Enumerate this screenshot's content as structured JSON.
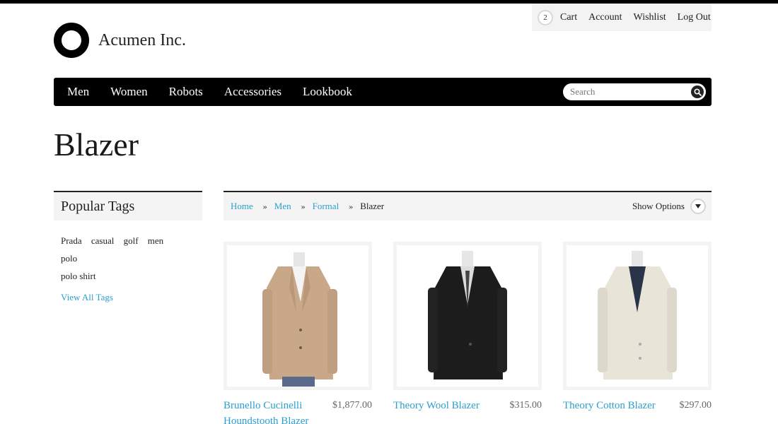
{
  "header": {
    "cart_count": "2",
    "links": [
      "Cart",
      "Account",
      "Wishlist",
      "Log Out"
    ],
    "brand": "Acumen Inc."
  },
  "nav": {
    "items": [
      "Men",
      "Women",
      "Robots",
      "Accessories",
      "Lookbook"
    ],
    "search_placeholder": "Search"
  },
  "page": {
    "title": "Blazer"
  },
  "sidebar": {
    "heading": "Popular Tags",
    "tags": [
      "Prada",
      "casual",
      "golf",
      "men",
      "polo",
      "polo shirt"
    ],
    "view_all": "View All Tags"
  },
  "breadcrumb": {
    "items": [
      "Home",
      "Men",
      "Formal"
    ],
    "separator": "»",
    "current": "Blazer",
    "show_options": "Show Options"
  },
  "products": [
    {
      "name": "Brunello Cucinelli Houndstooth Blazer",
      "price": "$1,877.00",
      "color": "#c8a888"
    },
    {
      "name": "Theory Wool Blazer",
      "price": "$315.00",
      "color": "#1c1c1c"
    },
    {
      "name": "Theory Cotton Blazer",
      "price": "$297.00",
      "color": "#e8e4d8"
    }
  ],
  "colors": {
    "accent": "#2a9fd0",
    "nav_bg": "#000000",
    "panel_bg": "#f4f4f4"
  }
}
